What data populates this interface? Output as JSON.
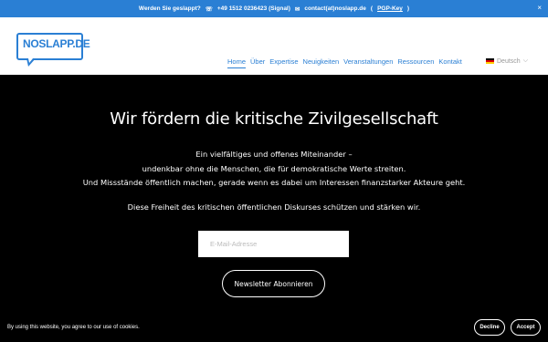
{
  "topbar": {
    "question": "Werden Sie geslappt?",
    "phone": "+49 1512 0236423 (Signal)",
    "email": "contact(at)noslapp.de",
    "key": "PGP-Key",
    "close": "×"
  },
  "logo": {
    "text": "NOSLAPP.DE",
    "color": "#2a7fd4"
  },
  "nav": {
    "items": [
      "Home",
      "Über",
      "Expertise",
      "Neuigkeiten",
      "Veranstaltungen",
      "Ressourcen",
      "Kontakt"
    ],
    "active": "Home",
    "language": "Deutsch"
  },
  "hero": {
    "title": "Wir fördern die kritische Zivilgesellschaft",
    "line1": "Ein vielfältiges und offenes Miteinander –",
    "line2": "undenkbar ohne die Menschen, die für demokratische Werte streiten.",
    "line3": "Und Missstände öffentlich machen, gerade wenn es dabei um Interessen finanzstarker Akteure geht.",
    "line4": "Diese Freiheit des kritischen öffentlichen Diskurses schützen und stärken wir."
  },
  "newsletter": {
    "placeholder": "E-Mail-Adresse",
    "button": "Newsletter Abonnieren"
  },
  "cookie": {
    "message": "By using this website, you agree to our use of cookies.",
    "decline": "Decline",
    "accept": "Accept"
  },
  "colors": {
    "accent": "#2a7fd4",
    "background": "#000000"
  }
}
